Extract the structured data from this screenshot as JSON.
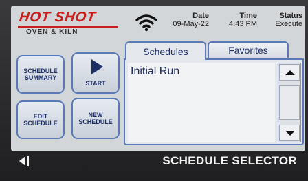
{
  "brand": {
    "name": "HOT SHOT",
    "tagline": "OVEN & KILN"
  },
  "header": {
    "date_label": "Date",
    "date_value": "09-May-22",
    "time_label": "Time",
    "time_value": "4:43 PM",
    "status_label": "Status",
    "status_value": "Execute"
  },
  "buttons": {
    "schedule_summary": "SCHEDULE\nSUMMARY",
    "start": "START",
    "edit_schedule": "EDIT\nSCHEDULE",
    "new_schedule": "NEW\nSCHEDULE"
  },
  "tabs": [
    {
      "label": "Schedules",
      "active": true
    },
    {
      "label": "Favorites",
      "active": false
    }
  ],
  "schedule_list": {
    "items": [
      "Initial Run"
    ]
  },
  "footer": {
    "title": "SCHEDULE SELECTOR"
  },
  "icons": {
    "wifi": "wifi-icon",
    "start": "play-icon",
    "back": "back-icon",
    "scroll_up": "arrow-up-icon",
    "scroll_down": "arrow-down-icon"
  },
  "colors": {
    "brand_red": "#c81e1e",
    "button_border": "#5a79b8",
    "button_text": "#1e2f66",
    "screen_bg": "#d3d6d9"
  }
}
